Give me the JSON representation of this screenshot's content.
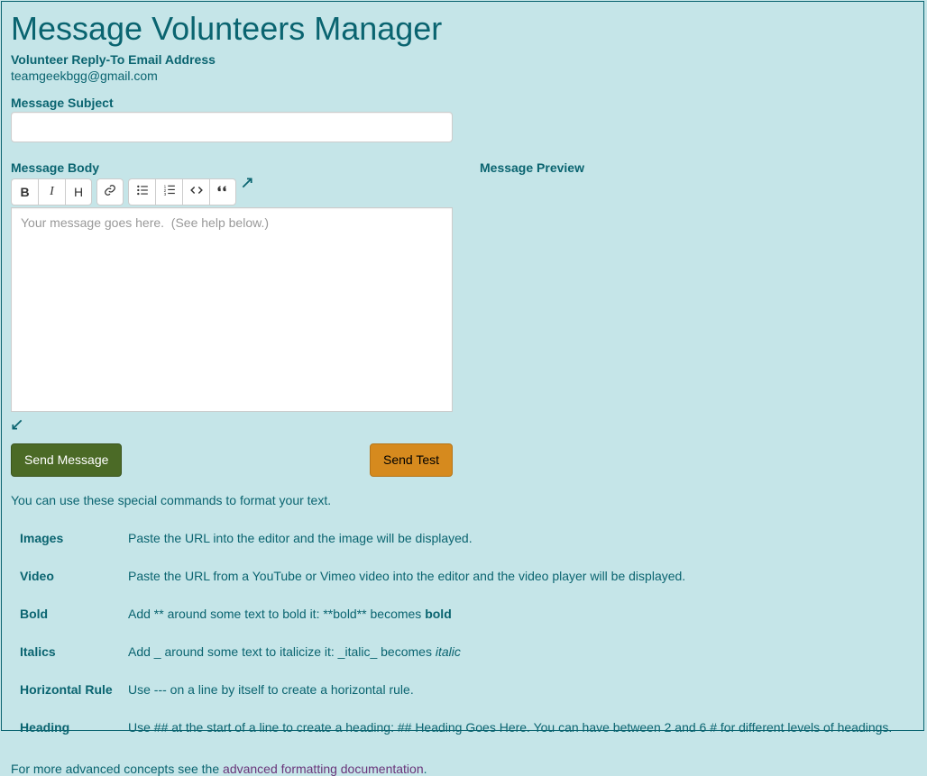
{
  "page": {
    "title": "Message Volunteers Manager"
  },
  "replyTo": {
    "label": "Volunteer Reply-To Email Address",
    "value": "teamgeekbgg@gmail.com"
  },
  "subject": {
    "label": "Message Subject",
    "value": ""
  },
  "body": {
    "label": "Message Body",
    "placeholder": "Your message goes here.  (See help below.)",
    "value": ""
  },
  "preview": {
    "label": "Message Preview"
  },
  "toolbar": {
    "bold": "B",
    "italic": "I",
    "heading": "H"
  },
  "icons": {
    "fold_expand": "↗",
    "fold_collapse": "↙"
  },
  "buttons": {
    "send": "Send Message",
    "test": "Send Test"
  },
  "help": {
    "intro": "You can use these special commands to format your text.",
    "rows": {
      "images": {
        "key": "Images",
        "desc": "Paste the URL into the editor and the image will be displayed."
      },
      "video": {
        "key": "Video",
        "desc": "Paste the URL from a YouTube or Vimeo video into the editor and the video player will be displayed."
      },
      "bold": {
        "key": "Bold",
        "desc_pre": "Add ** around some text to bold it: **bold** becomes ",
        "desc_b": "bold"
      },
      "italics": {
        "key": "Italics",
        "desc_pre": "Add _ around some text to italicize it: _italic_ becomes ",
        "desc_i": "italic"
      },
      "hr": {
        "key": "Horizontal Rule",
        "desc": "Use --- on a line by itself to create a horizontal rule."
      },
      "heading": {
        "key": "Heading",
        "desc": "Use ## at the start of a line to create a heading: ## Heading Goes Here. You can have between 2 and 6 # for different levels of headings."
      }
    },
    "footer_pre": "For more advanced concepts see the ",
    "footer_link": "advanced formatting documentation",
    "footer_post": "."
  }
}
